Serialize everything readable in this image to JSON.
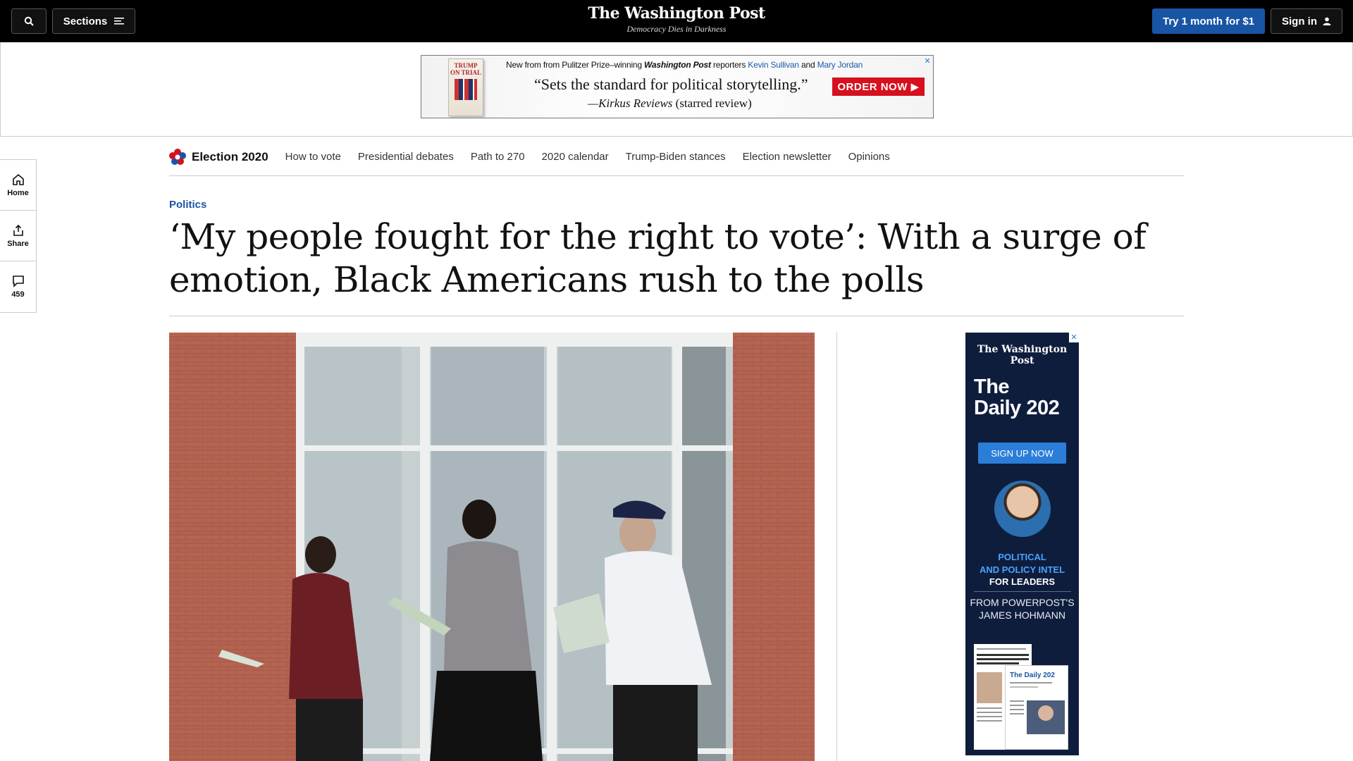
{
  "header": {
    "sections_label": "Sections",
    "logo_name": "The Washington Post",
    "logo_tagline": "Democracy Dies in Darkness",
    "try_label": "Try 1 month for $1",
    "signin_label": "Sign in"
  },
  "top_ad": {
    "book_title": "TRUMP ON TRIAL",
    "line_prefix": "New from from Pulitzer Prize–winning",
    "line_wp": "Washington Post",
    "line_reporters": "reporters",
    "reporter1": "Kevin Sullivan",
    "line_and": "and",
    "reporter2": "Mary Jordan",
    "quote": "“Sets the standard for political storytelling.”",
    "cite_source": "—Kirkus Reviews",
    "cite_note": "(starred review)",
    "order_label": "ORDER NOW ▶"
  },
  "rail": {
    "home_label": "Home",
    "share_label": "Share",
    "comments_count": "459"
  },
  "election_nav": {
    "brand": "Election 2020",
    "links": [
      "How to vote",
      "Presidential debates",
      "Path to 270",
      "2020 calendar",
      "Trump-Biden stances",
      "Election newsletter",
      "Opinions"
    ]
  },
  "article": {
    "kicker": "Politics",
    "headline": "‘My people fought for the right to vote’: With a surge of emotion, Black Americans rush to the polls"
  },
  "side_ad": {
    "wp": "The Washington Post",
    "title_line1": "The",
    "title_line2": "Daily 202",
    "signup": "SIGN UP NOW",
    "pol_line1": "POLITICAL",
    "pol_line2": "AND POLICY INTEL",
    "leaders": "FOR LEADERS",
    "from_line1": "FROM POWERPOST'S",
    "from_line2": "JAMES HOHMANN",
    "preview_title": "The Daily 202"
  },
  "colors": {
    "accent_blue": "#1955a5",
    "ad_red": "#d6101e",
    "ad_navy": "#0f1d3d"
  }
}
